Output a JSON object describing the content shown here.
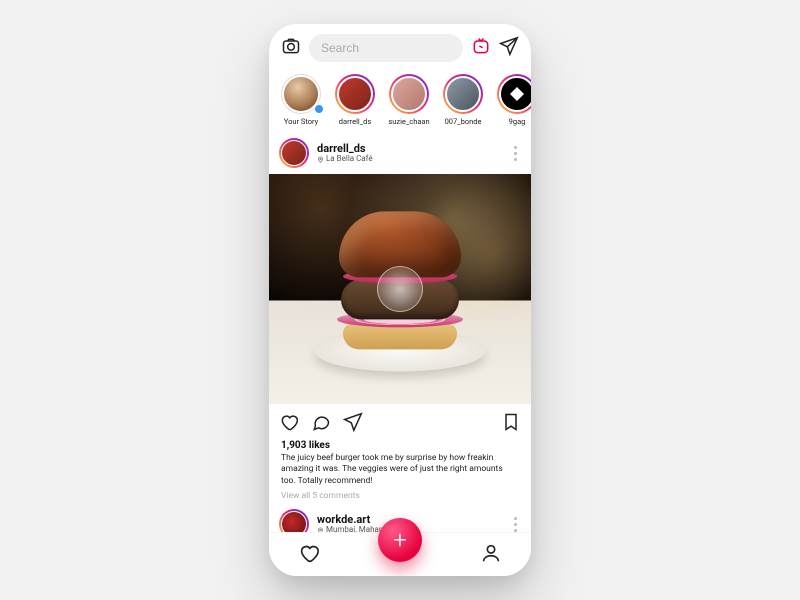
{
  "header": {
    "search_placeholder": "Search"
  },
  "stories": [
    {
      "label": "Your Story"
    },
    {
      "label": "darrell_ds"
    },
    {
      "label": "suzie_chaan"
    },
    {
      "label": "007_bonde"
    },
    {
      "label": "9gag"
    }
  ],
  "post": {
    "username": "darrell_ds",
    "location": "La Bella Café",
    "likes_text": "1,903 likes",
    "caption": "The juicy beef burger took me by surprise by how freakin amazing it was. The veggies were of just the right amounts too. Totally recommend!",
    "view_comments": "View all 5 comments"
  },
  "post2": {
    "username": "workde.art",
    "location": "Mumbai, Maharashtra"
  }
}
